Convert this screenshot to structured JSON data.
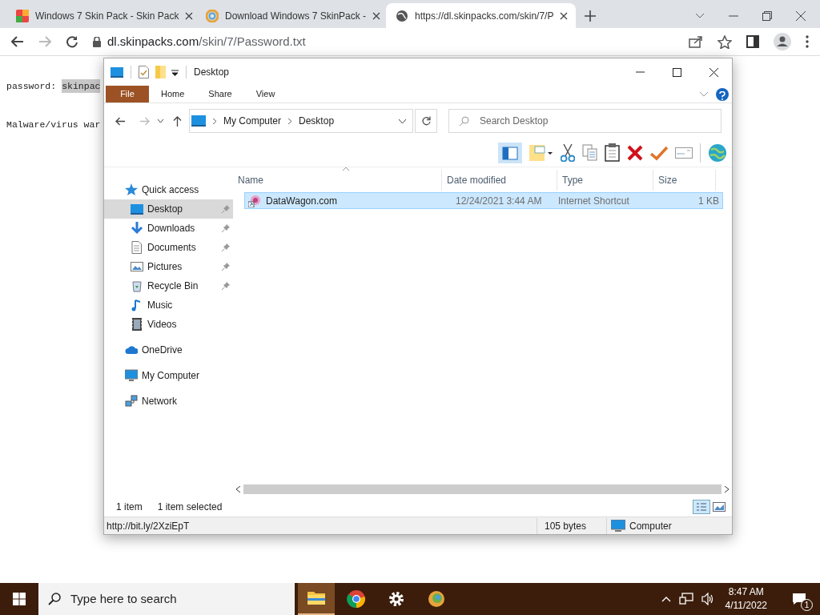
{
  "browser": {
    "tabs": [
      {
        "title": "Windows 7 Skin Pack - Skin Pack",
        "kind": "skinpack",
        "selected": false
      },
      {
        "title": "Download Windows 7 SkinPack -",
        "kind": "swirl",
        "selected": false
      },
      {
        "title": "https://dl.skinpacks.com/skin/7/P",
        "kind": "globe",
        "selected": true
      }
    ],
    "address": {
      "host": "dl.skinpacks.com",
      "path": "/skin/7/Password.txt"
    }
  },
  "page": {
    "password_line": {
      "label": "password:",
      "value": "skinpac",
      "highlighted": true
    },
    "warning_line": "Malware/virus war"
  },
  "explorer": {
    "title": "Desktop",
    "ribbon_tabs": [
      {
        "label": "File",
        "kind": "file"
      },
      {
        "label": "Home",
        "kind": "tab"
      },
      {
        "label": "Share",
        "kind": "tab"
      },
      {
        "label": "View",
        "kind": "tab"
      }
    ],
    "breadcrumb": [
      "My Computer",
      "Desktop"
    ],
    "search": {
      "placeholder": "Search Desktop"
    },
    "nav": [
      {
        "label": "Quick access",
        "kind": "star",
        "selected": false,
        "pinned": false,
        "children": [
          {
            "label": "Desktop",
            "kind": "desktop",
            "selected": true,
            "pinned": true
          },
          {
            "label": "Downloads",
            "kind": "download",
            "selected": false,
            "pinned": true
          },
          {
            "label": "Documents",
            "kind": "document",
            "selected": false,
            "pinned": true
          },
          {
            "label": "Pictures",
            "kind": "picture",
            "selected": false,
            "pinned": true
          },
          {
            "label": "Recycle Bin",
            "kind": "bin",
            "selected": false,
            "pinned": true
          },
          {
            "label": "Music",
            "kind": "music",
            "selected": false,
            "pinned": false
          },
          {
            "label": "Videos",
            "kind": "video",
            "selected": false,
            "pinned": false
          }
        ]
      },
      {
        "label": "OneDrive",
        "kind": "cloud",
        "selected": false,
        "pinned": false
      },
      {
        "label": "My Computer",
        "kind": "computer",
        "selected": false,
        "pinned": false
      },
      {
        "label": "Network",
        "kind": "network",
        "selected": false,
        "pinned": false
      }
    ],
    "columns": [
      "Name",
      "Date modified",
      "Type",
      "Size"
    ],
    "rows": [
      {
        "name": "DataWagon.com",
        "date": "12/24/2021 3:44 AM",
        "type": "Internet Shortcut",
        "size": "1 KB",
        "selected": true
      }
    ],
    "status": {
      "count": "1 item",
      "selection": "1 item selected"
    },
    "details_bar": {
      "link": "http://bit.ly/2XziEpT",
      "size": "105 bytes",
      "location": "Computer"
    }
  },
  "taskbar": {
    "search": {
      "placeholder": "Type here to search"
    },
    "apps": [
      {
        "kind": "folder",
        "active": true
      },
      {
        "kind": "chrome",
        "active": false
      },
      {
        "kind": "gear",
        "active": false
      },
      {
        "kind": "swirl",
        "active": false
      }
    ],
    "time": "8:47 AM",
    "date": "4/11/2022",
    "notifications": "1"
  }
}
